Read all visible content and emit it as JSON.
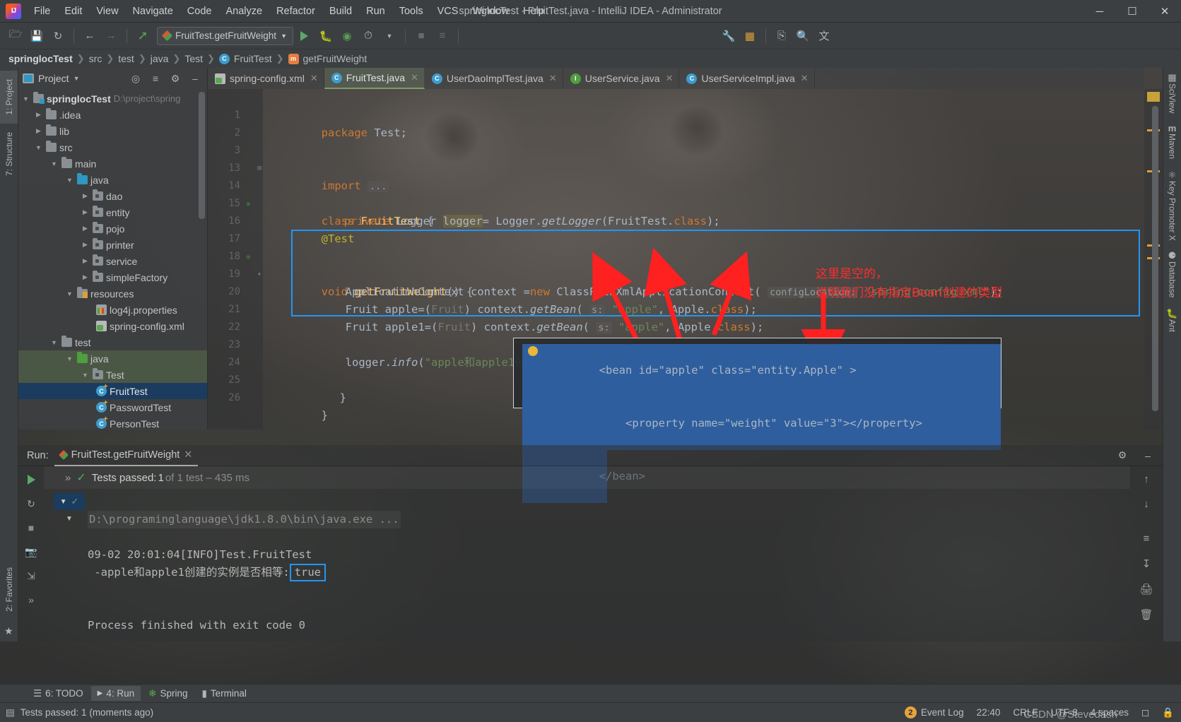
{
  "window": {
    "title": "springlocTest - FruitTest.java - IntelliJ IDEA - Administrator",
    "minimize": "─",
    "maximize": "☐",
    "close": "✕"
  },
  "menubar": [
    "File",
    "Edit",
    "View",
    "Navigate",
    "Code",
    "Analyze",
    "Refactor",
    "Build",
    "Run",
    "Tools",
    "VCS",
    "Window",
    "Help"
  ],
  "toolbar": {
    "run_config": "FruitTest.getFruitWeight",
    "icons": [
      "open-folder-icon",
      "save-icon",
      "sync-icon",
      "back-arrow-icon",
      "forward-arrow-icon",
      "build-hammer-icon",
      "run-icon",
      "debug-icon",
      "run-coverage-icon",
      "profiler-icon",
      "stop-icon",
      "run-anything-icon",
      "wrench-icon",
      "project-structure-icon",
      "update-icon",
      "search-icon",
      "translate-icon"
    ]
  },
  "breadcrumb": [
    "springlocTest",
    "src",
    "test",
    "java",
    "Test",
    "FruitTest",
    "getFruitWeight"
  ],
  "left_rail": [
    "1: Project",
    "7: Structure",
    "2: Favorites"
  ],
  "right_rail": [
    "SciView",
    "Maven",
    "Key Promoter X",
    "Database",
    "Ant"
  ],
  "project_panel": {
    "title": "Project",
    "buttons": [
      "locate-icon",
      "collapse-all-icon",
      "settings-gear-icon",
      "hide-icon"
    ],
    "tree": [
      {
        "label": "springlocTest",
        "path": "D:\\project\\spring",
        "depth": 0,
        "arrow": "down",
        "icon": "module-folder",
        "bold": true
      },
      {
        "label": ".idea",
        "depth": 1,
        "arrow": "right",
        "icon": "folder"
      },
      {
        "label": "lib",
        "depth": 1,
        "arrow": "right",
        "icon": "folder"
      },
      {
        "label": "src",
        "depth": 1,
        "arrow": "down",
        "icon": "folder"
      },
      {
        "label": "main",
        "depth": 2,
        "arrow": "down",
        "icon": "folder"
      },
      {
        "label": "java",
        "depth": 3,
        "arrow": "down",
        "icon": "source-folder-blue"
      },
      {
        "label": "dao",
        "depth": 4,
        "arrow": "right",
        "icon": "package"
      },
      {
        "label": "entity",
        "depth": 4,
        "arrow": "right",
        "icon": "package"
      },
      {
        "label": "pojo",
        "depth": 4,
        "arrow": "right",
        "icon": "package"
      },
      {
        "label": "printer",
        "depth": 4,
        "arrow": "right",
        "icon": "package"
      },
      {
        "label": "service",
        "depth": 4,
        "arrow": "right",
        "icon": "package"
      },
      {
        "label": "simpleFactory",
        "depth": 4,
        "arrow": "right",
        "icon": "package"
      },
      {
        "label": "resources",
        "depth": 3,
        "arrow": "down",
        "icon": "resource-folder"
      },
      {
        "label": "log4j.properties",
        "depth": 4,
        "arrow": "none",
        "icon": "properties-file"
      },
      {
        "label": "spring-config.xml",
        "depth": 4,
        "arrow": "none",
        "icon": "spring-xml-file"
      },
      {
        "label": "test",
        "depth": 2,
        "arrow": "down",
        "icon": "folder"
      },
      {
        "label": "java",
        "depth": 3,
        "arrow": "down",
        "icon": "test-source-folder-green",
        "highlight": "green"
      },
      {
        "label": "Test",
        "depth": 4,
        "arrow": "down",
        "icon": "package",
        "highlight": "green"
      },
      {
        "label": "FruitTest",
        "depth": 5,
        "arrow": "none",
        "icon": "java-test-class",
        "selected": true
      },
      {
        "label": "PasswordTest",
        "depth": 5,
        "arrow": "none",
        "icon": "java-test-class"
      },
      {
        "label": "PersonTest",
        "depth": 5,
        "arrow": "none",
        "icon": "java-test-class"
      }
    ]
  },
  "editor_tabs": [
    {
      "label": "spring-config.xml",
      "icon": "spring-xml-file",
      "active": false
    },
    {
      "label": "FruitTest.java",
      "icon": "java-test-class",
      "active": true
    },
    {
      "label": "UserDaoImplTest.java",
      "icon": "java-test-class",
      "active": false
    },
    {
      "label": "UserService.java",
      "icon": "java-interface",
      "active": false
    },
    {
      "label": "UserServiceImpl.java",
      "icon": "java-class",
      "active": false
    }
  ],
  "code": {
    "lines": [
      {
        "n": "1",
        "text": "package Test;"
      },
      {
        "n": "2",
        "text": ""
      },
      {
        "n": "3",
        "text": "import ...",
        "fold": true
      },
      {
        "n": "13",
        "text": ""
      },
      {
        "n": "14",
        "text": "class FruitTest {",
        "gmark": true
      },
      {
        "n": "15",
        "text": "    private Logger logger= Logger.getLogger(FruitTest.class);"
      },
      {
        "n": "16",
        "text": "@Test"
      },
      {
        "n": "17",
        "text": "void getFruitWeight() {",
        "gmark": true,
        "fold": true
      },
      {
        "n": "18",
        "text": ""
      },
      {
        "n": "19",
        "text": "ApplicationContext context =new ClassPathXmlApplicationContext( configLocation: \"spring-config.xml\");"
      },
      {
        "n": "20",
        "text": "Fruit apple=(Fruit) context.getBean( s: \"apple\", Apple.class);"
      },
      {
        "n": "21",
        "text": "Fruit apple1=(Fruit) context.getBean( s: \"apple\", Apple.class);"
      },
      {
        "n": "22",
        "text": "logger.info(\"apple和apple1创建的实例是否相等:\"+(apple==apple1));",
        "bulb": true
      },
      {
        "n": "23",
        "text": ""
      },
      {
        "n": "24",
        "text": ""
      },
      {
        "n": "25",
        "text": "    }"
      },
      {
        "n": "26",
        "text": "}"
      }
    ]
  },
  "xml_popup": {
    "lines": [
      "<bean id=\"apple\" class=\"entity.Apple\" >",
      "    <property name=\"weight\" value=\"3\"></property>",
      "</bean>"
    ]
  },
  "annotations": {
    "line1": "这里是空的，",
    "line2": "说明我们没有指定Bean创建的类型",
    "color": "#ff2d2d"
  },
  "run_panel": {
    "label": "Run:",
    "tab": "FruitTest.getFruitWeight",
    "tests_passed_prefix": "Tests passed: ",
    "tests_passed_count": "1",
    "tests_passed_suffix": " of 1 test – 435 ms",
    "console": {
      "cmd": "D:\\programinglanguage\\jdk1.8.0\\bin\\java.exe ...",
      "log_line1": "09-02 20:01:04[INFO]Test.FruitTest",
      "log_line2_prefix": " -apple和apple1创建的实例是否相等:",
      "log_line2_value": "true",
      "exit_line": "Process finished with exit code 0"
    },
    "toolbar_icons": [
      "rerun-icon",
      "rerun-failed-icon",
      "stop-icon",
      "camera-icon",
      "export-icon",
      "expand-icon"
    ],
    "right_icons": [
      "scroll-up-icon",
      "scroll-down-icon",
      "soft-wrap-icon",
      "scroll-to-end-icon",
      "print-icon",
      "trash-icon"
    ],
    "header_icons": [
      "settings-gear-icon",
      "hide-icon"
    ]
  },
  "bottom_tabs": [
    {
      "label": "6: TODO",
      "icon": "todo-icon",
      "active": false
    },
    {
      "label": "4: Run",
      "icon": "run-icon",
      "active": true
    },
    {
      "label": "Spring",
      "icon": "spring-leaf-icon",
      "active": false
    },
    {
      "label": "Terminal",
      "icon": "terminal-icon",
      "active": false
    }
  ],
  "statusbar": {
    "message": "Tests passed: 1 (moments ago)",
    "time": "22:40",
    "line_separator": "CRLF",
    "encoding": "UTF-8",
    "indent": "4 spaces",
    "event_log": "Event Log",
    "event_log_count": "2",
    "watermark": "CSDN @Stevedash"
  },
  "colors": {
    "accent_blue": "#2196f3",
    "annotation_red": "#ff2d2d",
    "selection_blue": "#2f5e9e",
    "tab_active_green": "#7f9a68",
    "string_green": "#6a8759",
    "keyword_orange": "#cc7832"
  }
}
